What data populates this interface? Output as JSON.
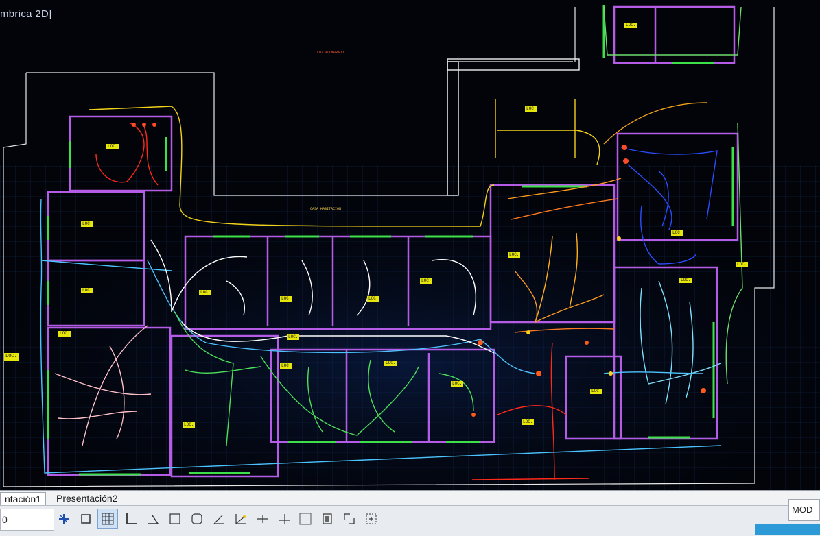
{
  "window": {
    "title_fragment": "mbrica 2D]"
  },
  "drawing": {
    "heading": "LUZ ALUMBRADO",
    "corridor_label": "CASA HABITACION",
    "room_tags": [
      "LOC.",
      "LOC.",
      "LOC.",
      "LOC.",
      "LOC.",
      "LOC.",
      "LOC.",
      "LOC.",
      "LOC.",
      "LOC.",
      "LOC.",
      "LOC.",
      "LOC.",
      "LOC.",
      "LOC.",
      "LOC.",
      "LOC.",
      "LOC.",
      "LOC.",
      "LOC.",
      "LOC.",
      "LOC."
    ],
    "grid_color": "#1f3d7a",
    "wall_color": "#b060e0",
    "circuit_colors": [
      "#ff2a1a",
      "#ffb020",
      "#ff7a20",
      "#2a4dff",
      "#4cc3ff",
      "#4ce05a",
      "#ffffff",
      "#f2e24a",
      "#ffb0c0"
    ]
  },
  "tabs": {
    "items": [
      {
        "label": "ntación1",
        "active": true
      },
      {
        "label": "Presentación2",
        "active": false
      }
    ]
  },
  "statusbar": {
    "coords": "0",
    "model_label": "MOD",
    "tools": [
      "cursor-icon",
      "rectangle-icon",
      "grid-icon",
      "ortho-icon",
      "polar-icon",
      "square-icon",
      "rounded-square-icon",
      "angle-icon",
      "tracking-icon",
      "snap-icon",
      "crosshair-icon",
      "box-icon",
      "lineweight-icon",
      "corner-icon",
      "selection-icon"
    ]
  }
}
